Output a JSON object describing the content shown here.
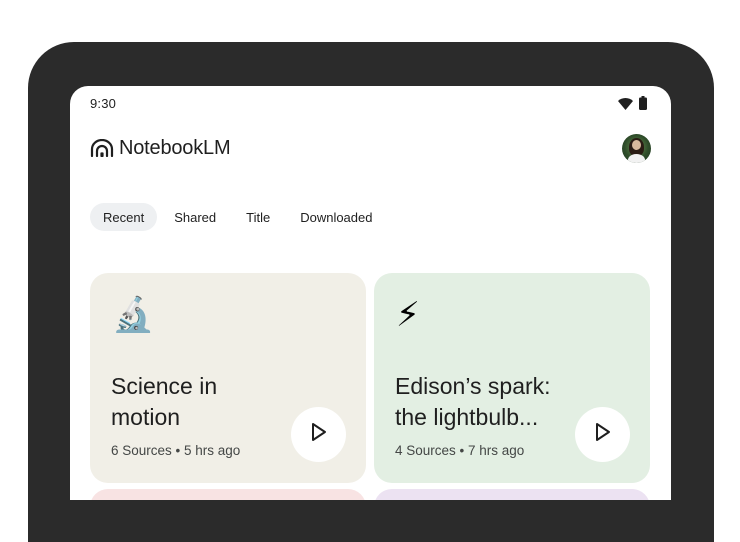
{
  "status_bar": {
    "time": "9:30"
  },
  "header": {
    "app_name": "NotebookLM"
  },
  "tabs": [
    {
      "label": "Recent",
      "active": true
    },
    {
      "label": "Shared",
      "active": false
    },
    {
      "label": "Title",
      "active": false
    },
    {
      "label": "Downloaded",
      "active": false
    }
  ],
  "notebooks": [
    {
      "emoji": "🔬",
      "icon": "microscope-icon",
      "title": "Science in motion",
      "meta": "6 Sources • 5 hrs ago",
      "background": "#f1efe7"
    },
    {
      "emoji": "⚡",
      "icon": "lightning-icon",
      "title": "Edison’s spark: the lightbulb...",
      "meta": "4 Sources • 7 hrs ago",
      "background": "#e3efe3"
    }
  ],
  "colors": {
    "device_frame": "#2b2b2b",
    "tab_active_bg": "#eef0f2",
    "peek_card_left": "#f8e3e3",
    "peek_card_right": "#ece2f2"
  }
}
